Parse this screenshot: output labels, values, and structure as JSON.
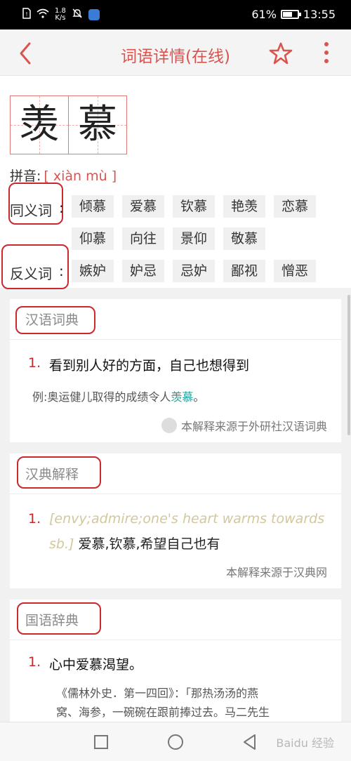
{
  "status_bar": {
    "net_speed_value": "1.8",
    "net_speed_unit": "K/s",
    "battery": "61%",
    "battery_fraction": 0.61,
    "time": "13:55"
  },
  "app_bar": {
    "title": "词语详情(在线)"
  },
  "word": {
    "chars": [
      "羡",
      "慕"
    ],
    "pinyin_label": "拼音:",
    "pinyin": "[ xiàn mù ]"
  },
  "synonyms": {
    "label": "同义词",
    "items": [
      "倾慕",
      "爱慕",
      "钦慕",
      "艳羡",
      "恋慕",
      "仰慕",
      "向往",
      "景仰",
      "敬慕"
    ]
  },
  "antonyms": {
    "label": "反义词",
    "items": [
      "嫉妒",
      "妒忌",
      "忌妒",
      "鄙视",
      "憎恶"
    ]
  },
  "sections": [
    {
      "title": "汉语词典",
      "num": "1.",
      "definition": "看到别人好的方面，自己也想得到",
      "example_prefix": "例:奥运健儿取得的成绩令人",
      "example_highlight": "羡慕",
      "example_suffix": "。",
      "source": "本解释来源于外研社汉语词典"
    },
    {
      "title": "汉典解释",
      "num": "1.",
      "english_line1": "[envy;admire;one's heart warms towards",
      "english_line2": "sb.]",
      "definition": "爱慕,钦慕,希望自己也有",
      "source": "本解释来源于汉典网"
    },
    {
      "title": "国语辞典",
      "num": "1.",
      "definition": "心中爱慕渴望。",
      "quote_line1": "《儒林外史．第一四回》：「那热汤汤的燕",
      "quote_line2": "窝、海参，一碗碗在跟前捧过去。马二先生"
    }
  ],
  "nav_bar": {
    "watermark": "Baidu 经验"
  },
  "colors": {
    "accent": "#d9534f",
    "annotation": "#c9282d",
    "highlight": "#1aa39d"
  }
}
